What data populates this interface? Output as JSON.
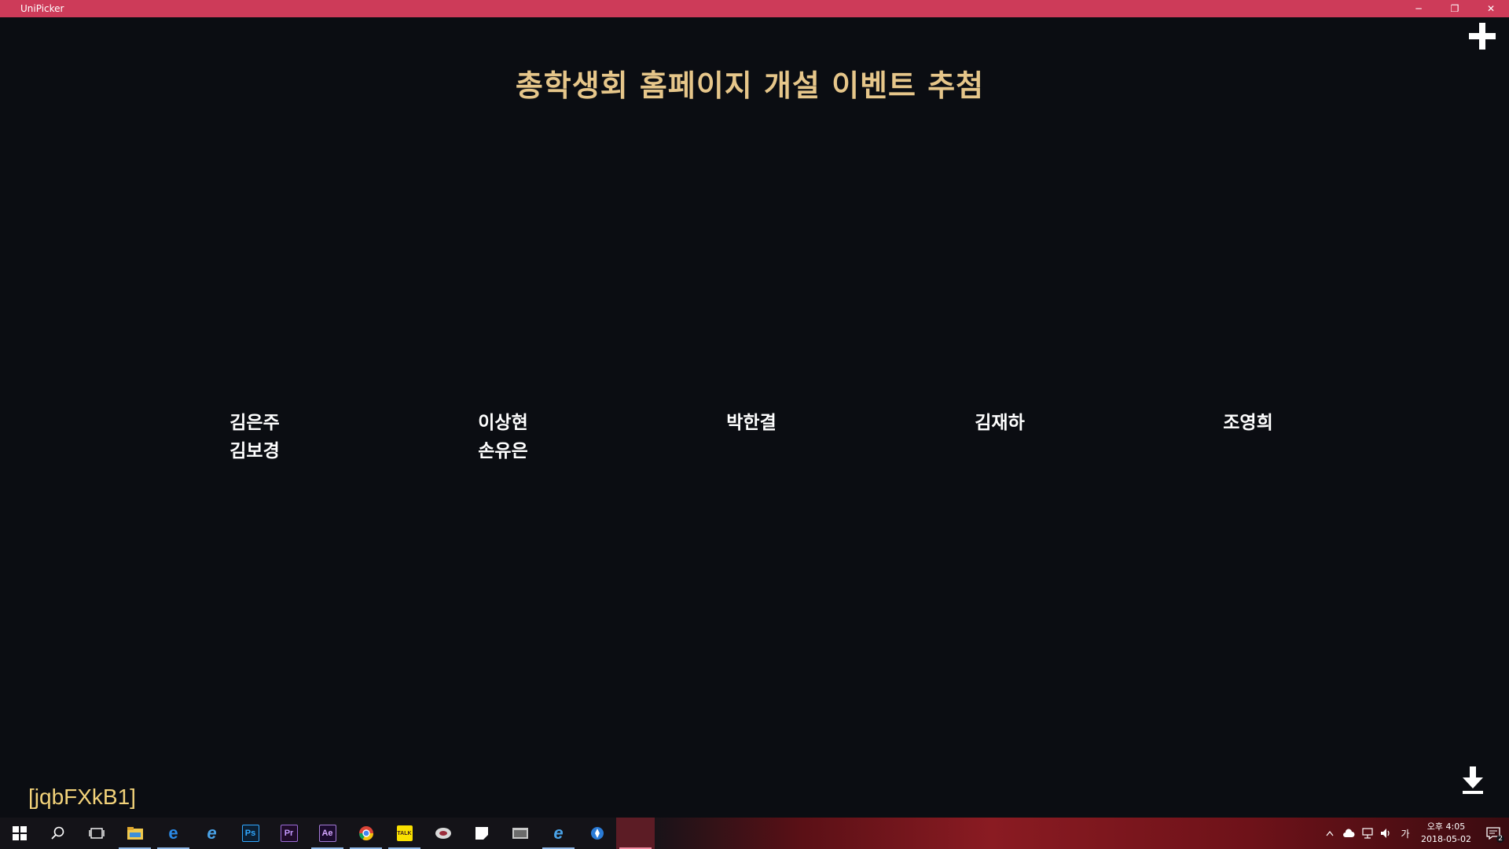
{
  "window": {
    "title": "UniPicker",
    "minimize_label": "─",
    "restore_label": "❐",
    "close_label": "✕"
  },
  "main": {
    "title": "총학생회 홈페이지 개설 이벤트 추첨",
    "winners": [
      [
        "김은주",
        "김보경"
      ],
      [
        "이상현",
        "손유은"
      ],
      [
        "박한결"
      ],
      [
        "김재하"
      ],
      [
        "조영희"
      ]
    ],
    "code": "[jqbFXkB1]"
  },
  "taskbar": {
    "icons": [
      {
        "name": "windows-start-icon",
        "label": ""
      },
      {
        "name": "search-icon",
        "label": ""
      },
      {
        "name": "task-view-icon",
        "label": ""
      },
      {
        "name": "file-explorer-icon",
        "label": ""
      },
      {
        "name": "edge-icon",
        "label": "e"
      },
      {
        "name": "internet-explorer-icon",
        "label": "e"
      },
      {
        "name": "photoshop-icon",
        "label": "Ps"
      },
      {
        "name": "premiere-icon",
        "label": "Pr"
      },
      {
        "name": "after-effects-icon",
        "label": "Ae"
      },
      {
        "name": "chrome-icon",
        "label": ""
      },
      {
        "name": "kakaotalk-icon",
        "label": "TALK"
      },
      {
        "name": "app-icon",
        "label": ""
      },
      {
        "name": "sticky-notes-icon",
        "label": ""
      },
      {
        "name": "app-window-icon",
        "label": ""
      },
      {
        "name": "internet-explorer-icon",
        "label": "e"
      },
      {
        "name": "pin-app-icon",
        "label": ""
      },
      {
        "name": "unipicker-icon",
        "label": ""
      }
    ],
    "tray": {
      "ime_label": "가",
      "time": "오후 4:05",
      "date": "2018-05-02",
      "notification_count": "2"
    }
  },
  "colors": {
    "titlebar": "#cd3b59",
    "background": "#0b0d12",
    "title_text": "#e6c68a",
    "code_text": "#f3d37a"
  }
}
